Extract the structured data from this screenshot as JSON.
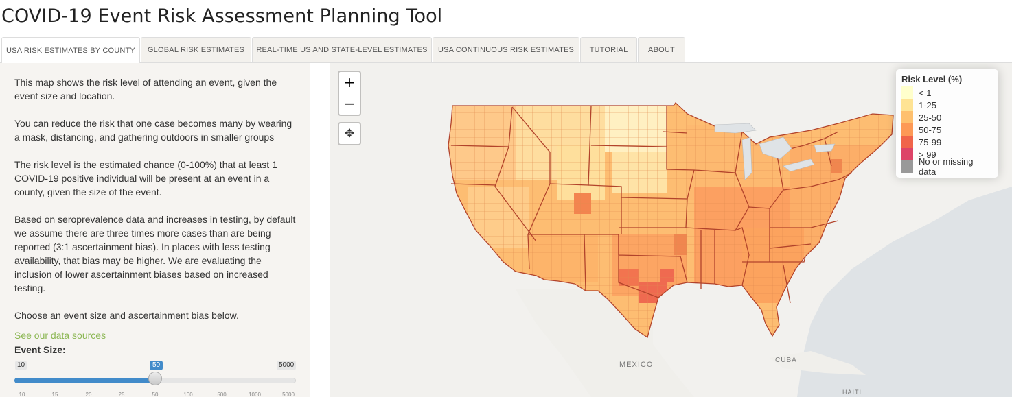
{
  "app": {
    "title": "COVID-19 Event Risk Assessment Planning Tool"
  },
  "tabs": [
    {
      "label": "USA RISK ESTIMATES BY COUNTY",
      "active": true
    },
    {
      "label": "GLOBAL RISK ESTIMATES",
      "active": false
    },
    {
      "label": "REAL-TIME US AND STATE-LEVEL ESTIMATES",
      "active": false
    },
    {
      "label": "USA CONTINUOUS RISK ESTIMATES",
      "active": false
    },
    {
      "label": "TUTORIAL",
      "active": false
    },
    {
      "label": "ABOUT",
      "active": false
    }
  ],
  "sidebar": {
    "paragraphs": [
      "This map shows the risk level of attending an event, given the event size and location.",
      "You can reduce the risk that one case becomes many by wearing a mask, distancing, and gathering outdoors in smaller groups",
      "The risk level is the estimated chance (0-100%) that at least 1 COVID-19 positive individual will be present at an event in a county, given the size of the event.",
      "Based on seroprevalence data and increases in testing, by default we assume there are three times more cases than are being reported (3:1 ascertainment bias). In places with less testing availability, that bias may be higher. We are evaluating the inclusion of lower ascertainment biases based on increased testing.",
      "Choose an event size and ascertainment bias below."
    ],
    "sources_link": "See our data sources",
    "event_size": {
      "label": "Event Size:",
      "min": "10",
      "max": "5000",
      "value": "50",
      "ticks": [
        "10",
        "15",
        "20",
        "25",
        "50",
        "100",
        "500",
        "1000",
        "5000"
      ]
    }
  },
  "map": {
    "zoom_in": "+",
    "zoom_out": "−",
    "locate_icon": "crosshair-icon",
    "labels": {
      "mexico": "MEXICO",
      "cuba": "CUBA",
      "haiti": "HAITI"
    },
    "legend": {
      "title": "Risk Level (%)",
      "items": [
        {
          "label": "< 1",
          "color": "#ffffcc"
        },
        {
          "label": "1-25",
          "color": "#fee394"
        },
        {
          "label": "25-50",
          "color": "#fec06e"
        },
        {
          "label": "50-75",
          "color": "#fd9956"
        },
        {
          "label": "75-99",
          "color": "#f0644a"
        },
        {
          "label": "> 99",
          "color": "#dd4468"
        },
        {
          "label": "No or missing data",
          "color": "#999999"
        }
      ]
    }
  }
}
